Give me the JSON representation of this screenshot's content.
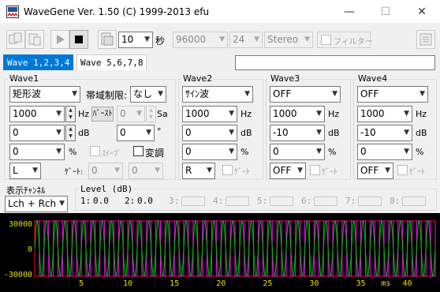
{
  "window": {
    "title": "WaveGene  Ver. 1.50  (C) 1999-2013 efu",
    "min_glyph": "—",
    "max_glyph": "☐",
    "close_glyph": "✕"
  },
  "toolbar": {
    "duration_value": "10",
    "duration_unit": "秒",
    "sample_rate": "96000",
    "bits": "24",
    "channels": "Stereo",
    "filter_label": "フィルター"
  },
  "tabs": {
    "tab1": "Wave 1,2,3,4",
    "tab2": "Wave 5,6,7,8"
  },
  "wave1": {
    "title": "Wave1",
    "waveform": "矩形波",
    "band_label": "帯域制限:",
    "band_value": "なし",
    "freq": "1000",
    "freq_unit": "Hz",
    "burst_label": "ﾊﾞｰｽﾄ",
    "burst_value": "0",
    "sa_unit": "Sa",
    "level": "0",
    "level_unit": "dB",
    "phase": "0",
    "phase_unit": "°",
    "duty": "0",
    "duty_unit": "%",
    "sweep_label": "ｽｲｰﾌﾟ",
    "modulate_label": "変調",
    "channel": "L",
    "gate_label": "ｹﾞｰﾄ:",
    "gate_val1": "0",
    "gate_val2": "0"
  },
  "wave2": {
    "title": "Wave2",
    "waveform": "ｻｲﾝ波",
    "freq": "1000",
    "freq_unit": "Hz",
    "level": "0",
    "level_unit": "dB",
    "duty": "0",
    "duty_unit": "%",
    "channel": "R",
    "gate_label": "ｹﾞｰﾄ"
  },
  "wave3": {
    "title": "Wave3",
    "waveform": "OFF",
    "freq": "1000",
    "freq_unit": "Hz",
    "level": "-10",
    "level_unit": "dB",
    "duty": "0",
    "duty_unit": "%",
    "channel": "OFF",
    "gate_label": "ｹﾞｰﾄ"
  },
  "wave4": {
    "title": "Wave4",
    "waveform": "OFF",
    "freq": "1000",
    "freq_unit": "Hz",
    "level": "-10",
    "level_unit": "dB",
    "duty": "0",
    "duty_unit": "%",
    "channel": "OFF",
    "gate_label": "ｹﾞｰﾄ"
  },
  "display": {
    "label": "表示ﾁｬﾝﾈﾙ",
    "value": "Lch + Rch"
  },
  "levels": {
    "title": "Level (dB)",
    "items": [
      {
        "label": "1:",
        "value": "0.0"
      },
      {
        "label": "2:",
        "value": "0.0"
      },
      {
        "label": "3:",
        "value": ""
      },
      {
        "label": "4:",
        "value": ""
      },
      {
        "label": "5:",
        "value": ""
      },
      {
        "label": "6:",
        "value": ""
      },
      {
        "label": "7:",
        "value": ""
      },
      {
        "label": "8:",
        "value": ""
      }
    ]
  },
  "chart_data": {
    "type": "line",
    "y_ticks": [
      "30000",
      "0",
      "-30000"
    ],
    "ylim": [
      -32768,
      32767
    ],
    "x_ticks": [
      "5",
      "10",
      "15",
      "20",
      "25",
      "30",
      "35",
      "40"
    ],
    "x_unit": "ms",
    "xlim": [
      0,
      43
    ],
    "series": [
      {
        "type": "square",
        "frequency_hz": 1000,
        "amplitude": 32767,
        "color": "#ff00ff"
      },
      {
        "type": "sine",
        "frequency_hz": 1000,
        "amplitude": 32767,
        "color": "#00c000"
      }
    ]
  },
  "colors": {
    "scope_bg": "#000000",
    "grid": "#00a000",
    "axis_text": "#e0e000",
    "border": "#ff0000",
    "tab_active": "#0078d7"
  }
}
